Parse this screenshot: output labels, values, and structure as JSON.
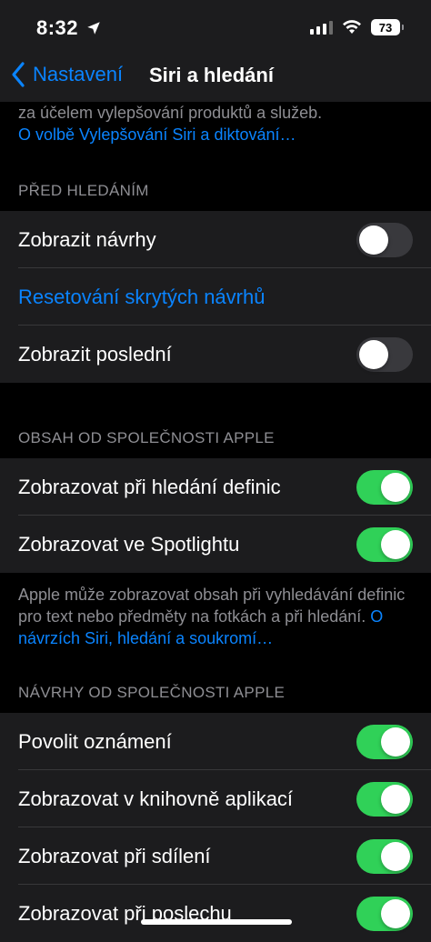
{
  "status": {
    "time": "8:32",
    "battery": "73"
  },
  "nav": {
    "back_label": "Nastavení",
    "title": "Siri a hledání"
  },
  "top_note": {
    "text": "za účelem vylepšování produktů a služeb.",
    "link": "O volbě Vylepšování Siri a diktování…"
  },
  "sections": {
    "before_search": {
      "header": "PŘED HLEDÁNÍM",
      "rows": [
        {
          "label": "Zobrazit návrhy",
          "toggle": false
        },
        {
          "label": "Resetování skrytých návrhů"
        },
        {
          "label": "Zobrazit poslední",
          "toggle": false
        }
      ]
    },
    "apple_content": {
      "header": "OBSAH OD SPOLEČNOSTI APPLE",
      "rows": [
        {
          "label": "Zobrazovat při hledání definic",
          "toggle": true
        },
        {
          "label": "Zobrazovat ve Spotlightu",
          "toggle": true
        }
      ],
      "footer_text": "Apple může zobrazovat obsah při vyhledávání definic pro text nebo předměty na fotkách a při hledání. ",
      "footer_link": "O návrzích Siri, hledání a soukromí…"
    },
    "apple_suggestions": {
      "header": "NÁVRHY OD SPOLEČNOSTI APPLE",
      "rows": [
        {
          "label": "Povolit oznámení",
          "toggle": true
        },
        {
          "label": "Zobrazovat v knihovně aplikací",
          "toggle": true
        },
        {
          "label": "Zobrazovat při sdílení",
          "toggle": true
        },
        {
          "label": "Zobrazovat při poslechu",
          "toggle": true
        }
      ]
    }
  },
  "colors": {
    "accent": "#0a84ff",
    "toggle_on": "#30d158",
    "toggle_off": "#39393d"
  }
}
